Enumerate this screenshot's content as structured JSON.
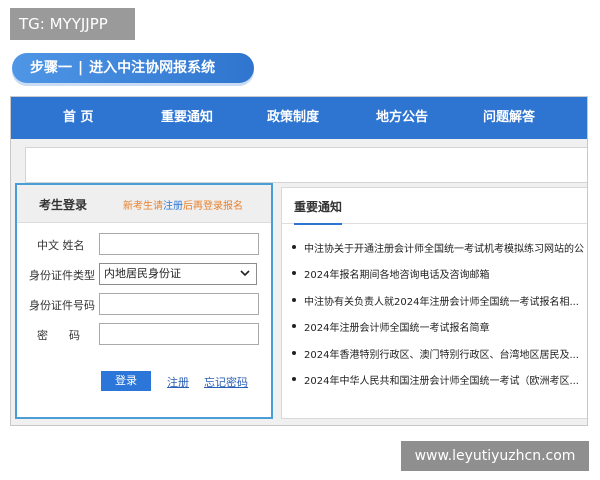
{
  "watermark": {
    "tg": "TG: MYYJJPP",
    "site": "www.leyutiyuzhcn.com"
  },
  "step": {
    "label": "步骤一",
    "separator": "|",
    "title": "进入中注协网报系统"
  },
  "nav": {
    "items": [
      "首 页",
      "重要通知",
      "政策制度",
      "地方公告",
      "问题解答"
    ]
  },
  "login": {
    "title": "考生登录",
    "hint_part1": "新考生请",
    "hint_link": "注册",
    "hint_part2": "后再登录报名",
    "fields": {
      "name_label": "中文  姓名",
      "id_type_label": "身份证件类型",
      "id_type_value": "内地居民身份证",
      "id_no_label": "身份证件号码",
      "password_label": "密      码"
    },
    "login_button": "登录",
    "register_link": "注册",
    "forgot_link": "忘记密码"
  },
  "notices": {
    "title": "重要通知",
    "items": [
      "中注协关于开通注册会计师全国统一考试机考模拟练习网站的公",
      "2024年报名期间各地咨询电话及咨询邮箱",
      "中注协有关负责人就2024年注册会计师全国统一考试报名相...",
      "2024年注册会计师全国统一考试报名简章",
      "2024年香港特别行政区、澳门特别行政区、台湾地区居民及...",
      "2024年中华人民共和国注册会计师全国统一考试（欧洲考区..."
    ]
  },
  "colors": {
    "nav": "#2e75d2",
    "accent": "#4a9dd6",
    "orange": "#e8812d"
  }
}
